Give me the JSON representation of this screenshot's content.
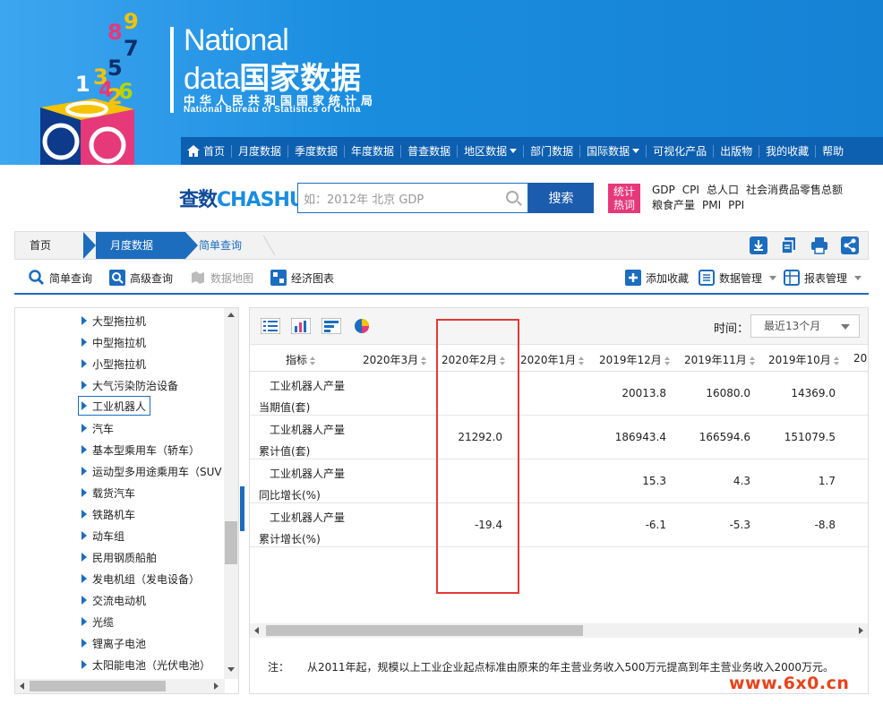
{
  "brand": {
    "en_line1": "National",
    "en_line2": "data",
    "cn_big": "国家数据",
    "cn_sub": "中华人民共和国国家统计局",
    "en_sub": "National Bureau of Statistics of China",
    "digits": [
      "9",
      "8",
      "7",
      "5",
      "1",
      "3",
      "4",
      "2",
      "6"
    ]
  },
  "nav": {
    "items": [
      {
        "label": "首页",
        "dropdown": false
      },
      {
        "label": "月度数据",
        "dropdown": false
      },
      {
        "label": "季度数据",
        "dropdown": false
      },
      {
        "label": "年度数据",
        "dropdown": false
      },
      {
        "label": "普查数据",
        "dropdown": false
      },
      {
        "label": "地区数据",
        "dropdown": true
      },
      {
        "label": "部门数据",
        "dropdown": false
      },
      {
        "label": "国际数据",
        "dropdown": true
      },
      {
        "label": "可视化产品",
        "dropdown": false
      },
      {
        "label": "出版物",
        "dropdown": false
      },
      {
        "label": "我的收藏",
        "dropdown": false
      },
      {
        "label": "帮助",
        "dropdown": false
      }
    ]
  },
  "search": {
    "logo_cn": "查数",
    "logo_en": "CHASHU",
    "placeholder": "如：2012年 北京 GDP",
    "button": "搜索",
    "hot_badge_line1": "统计",
    "hot_badge_line2": "热词",
    "hot_words_row1": [
      "GDP",
      "CPI",
      "总人口",
      "社会消费品零售总额"
    ],
    "hot_words_row2": [
      "粮食产量",
      "PMI",
      "PPI"
    ]
  },
  "breadcrumb": {
    "home": "首页",
    "section": "月度数据",
    "current": "简单查询"
  },
  "toolbar": {
    "simple_query": "简单查询",
    "advanced_query": "高级查询",
    "data_map": "数据地图",
    "econ_chart": "经济图表",
    "add_favorite": "添加收藏",
    "data_manage": "数据管理",
    "report_manage": "报表管理"
  },
  "tree": {
    "items": [
      "大型拖拉机",
      "中型拖拉机",
      "小型拖拉机",
      "大气污染防治设备",
      "工业机器人",
      "汽车",
      "基本型乘用车（轿车）",
      "运动型多用途乘用车（SUV",
      "载货汽车",
      "铁路机车",
      "动车组",
      "民用钢质船舶",
      "发电机组（发电设备）",
      "交流电动机",
      "光缆",
      "锂离子电池",
      "太阳能电池（光伏电池）"
    ],
    "selected_index": 4
  },
  "panel": {
    "time_label": "时间：",
    "time_value": "最近13个月",
    "columns": [
      "指标",
      "2020年3月",
      "2020年2月",
      "2020年1月",
      "2019年12月",
      "2019年11月",
      "2019年10月",
      "201"
    ],
    "rows": [
      {
        "label1": "工业机器人产量",
        "label2": "当期值(套)",
        "values": [
          "",
          "",
          "",
          "20013.8",
          "16080.0",
          "14369.0"
        ]
      },
      {
        "label1": "工业机器人产量",
        "label2": "累计值(套)",
        "values": [
          "",
          "21292.0",
          "",
          "186943.4",
          "166594.6",
          "151079.5"
        ]
      },
      {
        "label1": "工业机器人产量",
        "label2": "同比增长(%)",
        "values": [
          "",
          "",
          "",
          "15.3",
          "4.3",
          "1.7"
        ]
      },
      {
        "label1": "工业机器人产量",
        "label2": "累计增长(%)",
        "values": [
          "",
          "-19.4",
          "",
          "-6.1",
          "-5.3",
          "-8.8"
        ]
      }
    ],
    "note_label": "注：",
    "note_text": "从2011年起，规模以上工业企业起点标准由原来的年主营业务收入500万元提高到年主营业务收入2000万元。"
  },
  "watermark": "www.6x0.cn",
  "colors": {
    "header_blue": "#1a8ddf",
    "nav_blue": "#0d5fb0",
    "accent": "#1c6dbd",
    "hot_pink": "#e6397a",
    "highlight_red": "#e53935",
    "watermark": "#e8431b"
  }
}
